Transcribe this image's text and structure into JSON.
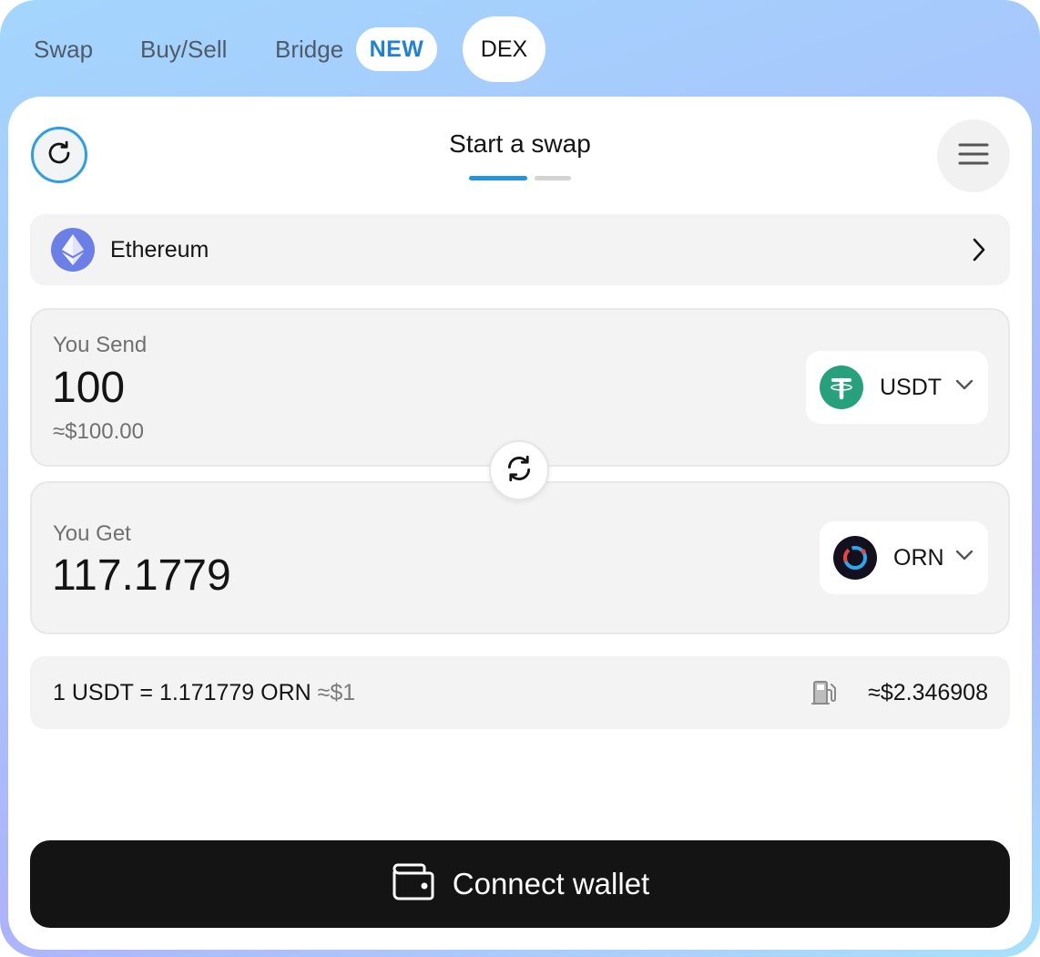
{
  "tabs": {
    "swap": "Swap",
    "buy_sell": "Buy/Sell",
    "bridge": "Bridge",
    "bridge_badge": "NEW",
    "dex": "DEX",
    "active": "DEX"
  },
  "header": {
    "title": "Start a swap",
    "step_current": 1,
    "step_total": 2,
    "refresh_icon": "refresh-icon",
    "menu_icon": "hamburger-menu-icon"
  },
  "network": {
    "name": "Ethereum",
    "icon": "ethereum-icon"
  },
  "send": {
    "label": "You Send",
    "amount": "100",
    "usd_value": "≈$100.00",
    "token": "USDT",
    "token_icon": "tether-icon"
  },
  "get": {
    "label": "You Get",
    "amount": "117.1779",
    "token": "ORN",
    "token_icon": "orion-icon"
  },
  "rate": {
    "text": "1 USDT = 1.171779 ORN",
    "usd": "≈$1",
    "gas_icon": "gas-pump-icon",
    "gas_fee": "≈$2.346908"
  },
  "action": {
    "connect_label": "Connect wallet",
    "icon": "wallet-icon"
  },
  "colors": {
    "accent": "#2194e3",
    "badge_text": "#1f82d5",
    "tether_green": "#26a17b",
    "ethereum_purple": "#6b7fe6",
    "primary_button": "#141414"
  }
}
